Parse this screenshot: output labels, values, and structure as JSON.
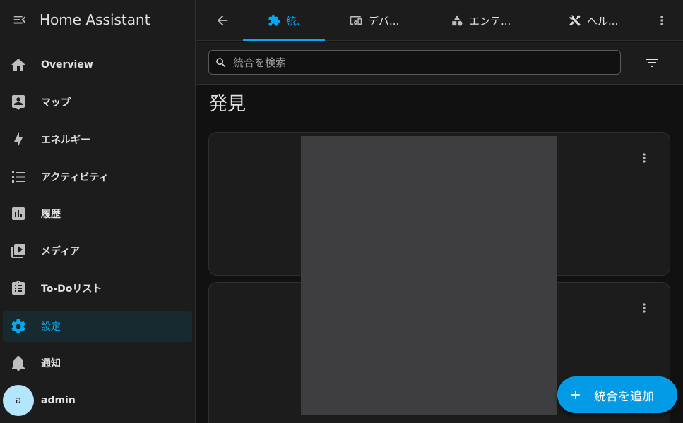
{
  "sidebar": {
    "title": "Home Assistant",
    "items": [
      {
        "label": "Overview",
        "icon": "home-icon"
      },
      {
        "label": "マップ",
        "icon": "map-account-icon"
      },
      {
        "label": "エネルギー",
        "icon": "lightning-icon"
      },
      {
        "label": "アクティビティ",
        "icon": "format-list-icon"
      },
      {
        "label": "履歴",
        "icon": "chart-box-icon"
      },
      {
        "label": "メディア",
        "icon": "play-box-multiple-icon"
      },
      {
        "label": "To-Doリスト",
        "icon": "clipboard-list-icon"
      },
      {
        "label": "設定",
        "icon": "gear-icon",
        "active": true
      },
      {
        "label": "通知",
        "icon": "bell-icon"
      }
    ],
    "user": {
      "initial": "a",
      "name": "admin"
    }
  },
  "tabs": [
    {
      "label": "統.",
      "icon": "puzzle-icon",
      "active": true
    },
    {
      "label": "デバ...",
      "icon": "devices-icon"
    },
    {
      "label": "エンテ...",
      "icon": "shapes-icon"
    },
    {
      "label": "ヘル...",
      "icon": "tools-icon"
    }
  ],
  "search": {
    "placeholder": "統合を検索",
    "value": ""
  },
  "main": {
    "heading": "発見"
  },
  "fab": {
    "label": "統合を追加"
  },
  "colors": {
    "accent": "#03a9f4",
    "fab": "#039be5",
    "background": "#111111",
    "surface": "#1c1c1c"
  }
}
